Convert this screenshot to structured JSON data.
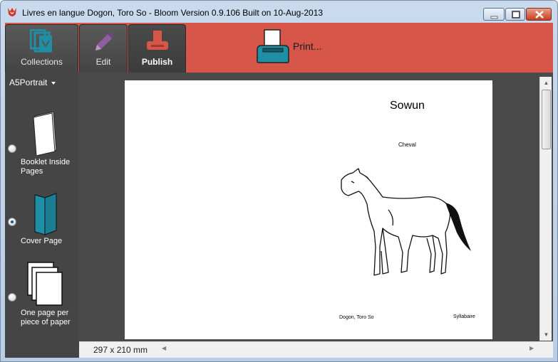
{
  "window": {
    "title": "Livres en langue Dogon, Toro So - Bloom Version 0.9.106 Built on 10-Aug-2013",
    "app_icon": "bloom-tulip-icon",
    "controls": [
      "minimize-icon",
      "maximize-icon",
      "close-icon"
    ]
  },
  "tabs": [
    {
      "label": "Collections",
      "icon": "collections-icon",
      "selected": false
    },
    {
      "label": "Edit",
      "icon": "pencil-icon",
      "selected": false
    },
    {
      "label": "Publish",
      "icon": "publish-icon",
      "selected": true
    }
  ],
  "toolbar": {
    "print_label": "Print...",
    "print_icon": "printer-icon"
  },
  "layout": {
    "selected": "A5Portrait"
  },
  "publish_options": [
    {
      "label": "Booklet Inside Pages",
      "icon": "booklet-icon",
      "checked": false
    },
    {
      "label": "Cover Page",
      "icon": "cover-icon",
      "checked": true
    },
    {
      "label": "One page per piece of paper",
      "icon": "pages-icon",
      "checked": false
    }
  ],
  "preview": {
    "title": "Sowun",
    "subtitle": "Cheval",
    "image": "horse-illustration",
    "footer_left": "Dogon, Toro So",
    "footer_right": "Syllabaire",
    "page_size": "297 x 210 mm"
  },
  "colors": {
    "toolbar_red": "#d65649",
    "pane_gray": "#454545",
    "icon_teal": "#1f8fa6"
  }
}
